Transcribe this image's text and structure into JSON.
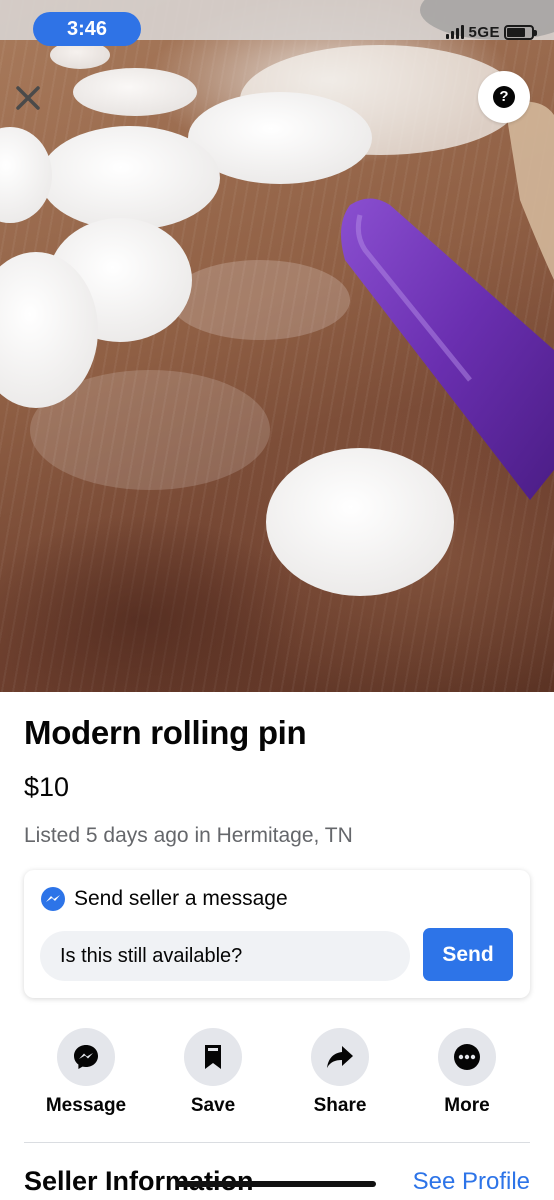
{
  "status_bar": {
    "time": "3:46",
    "network": "5GE",
    "battery_level": 0.75
  },
  "overlay": {
    "close_icon": "close-icon",
    "help_label": "?"
  },
  "listing": {
    "title": "Modern rolling pin",
    "price": "$10",
    "listed_text": "Listed 5 days ago in Hermitage, TN"
  },
  "message_card": {
    "header_label": "Send seller a message",
    "input_value": "Is this still available?",
    "send_label": "Send"
  },
  "actions": [
    {
      "label": "Message",
      "icon": "messenger-icon"
    },
    {
      "label": "Save",
      "icon": "bookmark-icon"
    },
    {
      "label": "Share",
      "icon": "share-arrow-icon"
    },
    {
      "label": "More",
      "icon": "more-dots-icon"
    }
  ],
  "seller_section": {
    "title": "Seller Information",
    "link": "See Profile"
  },
  "colors": {
    "accent": "#2d74e8",
    "text": "#050505",
    "muted": "#65676b",
    "rolling_pin": "#6a2fb0"
  }
}
